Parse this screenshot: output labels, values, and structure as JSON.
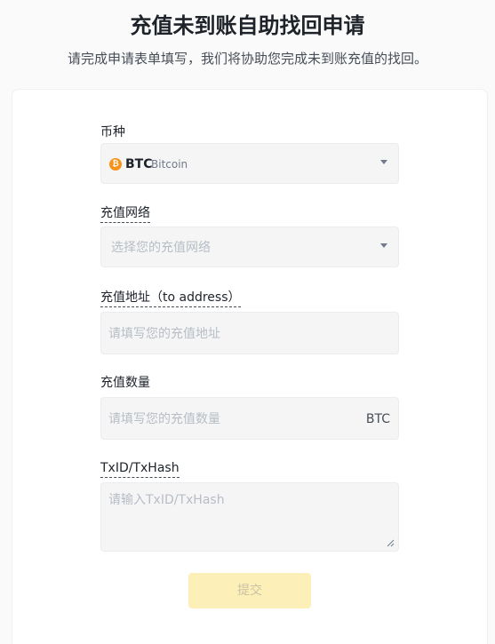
{
  "header": {
    "title": "充值未到账自助找回申请",
    "subtitle": "请完成申请表单填写，我们将协助您完成未到账充值的找回。"
  },
  "form": {
    "coin": {
      "label": "币种",
      "icon": "bitcoin-icon",
      "icon_glyph": "₿",
      "symbol": "BTC",
      "name": "Bitcoin"
    },
    "network": {
      "label": "充值网络",
      "placeholder": "选择您的充值网络"
    },
    "address": {
      "label": "充值地址（to address）",
      "placeholder": "请填写您的充值地址"
    },
    "amount": {
      "label": "充值数量",
      "placeholder": "请填写您的充值数量",
      "unit": "BTC"
    },
    "txid": {
      "label": "TxID/TxHash",
      "placeholder": "请输入TxID/TxHash"
    },
    "submit_label": "提交"
  },
  "colors": {
    "accent_disabled": "#fcf0b8",
    "coin_btc": "#f7931a"
  }
}
